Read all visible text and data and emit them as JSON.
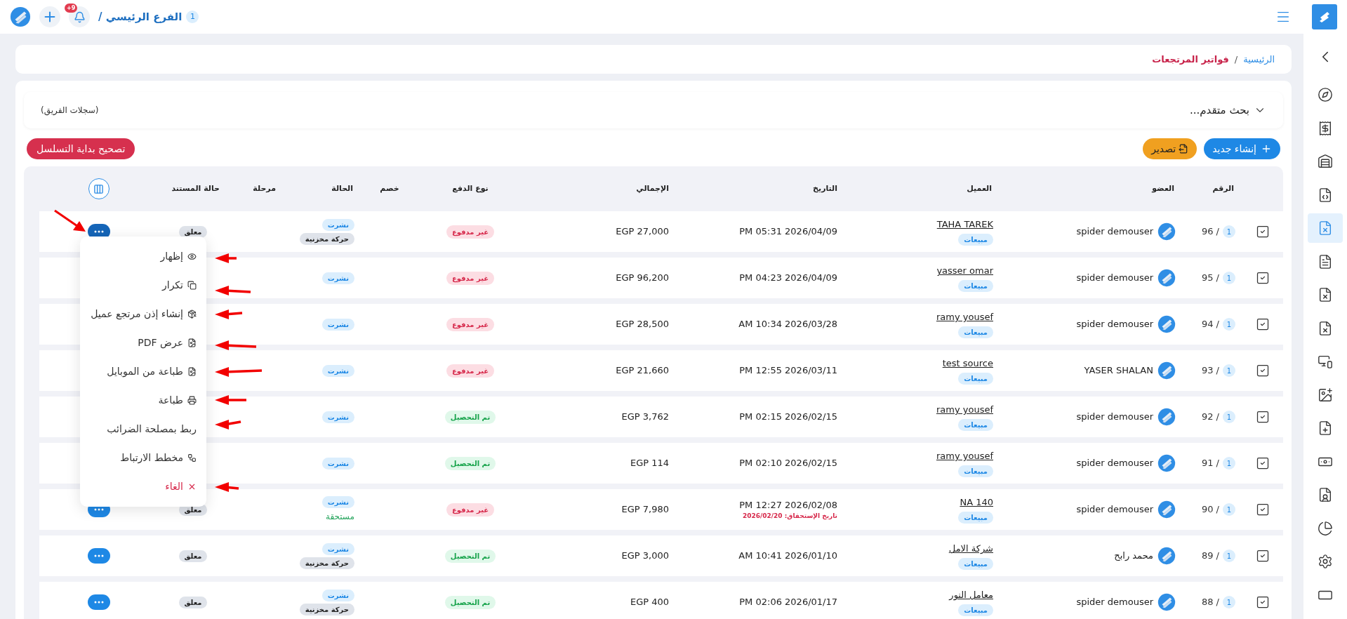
{
  "top_bar": {
    "branch": {
      "badge": "1",
      "name": "الفرع الرئيسي /"
    },
    "notifications": {
      "count": "+9"
    }
  },
  "breadcrumb": {
    "home": "الرئيسية",
    "separator": "/",
    "current": "فواتير المرتجعات"
  },
  "sidebar": {
    "items": [
      {
        "selected": false
      },
      {
        "selected": false
      },
      {
        "selected": false
      },
      {
        "selected": false
      },
      {
        "selected": true
      },
      {
        "selected": false
      },
      {
        "selected": false
      },
      {
        "selected": false
      },
      {
        "selected": false
      },
      {
        "selected": false
      },
      {
        "selected": false
      },
      {
        "selected": false
      },
      {
        "selected": false
      },
      {
        "selected": false
      },
      {
        "selected": false
      },
      {
        "selected": false
      }
    ]
  },
  "search": {
    "label": "بحث متقدم...",
    "expanded": false,
    "scope": "(سجلات الفريق)"
  },
  "actions": {
    "create": "إنشاء جديد",
    "export": "تصدير",
    "fix_sequence": "تصحيح بداية التسلسل"
  },
  "table": {
    "columns": [
      "الرقم",
      "العضو",
      "العميل",
      "التاريخ",
      "الإجمالي",
      "نوع الدفع",
      "خصم",
      "الحالة",
      "مرحلة",
      "حالة المستند"
    ],
    "rows": [
      {
        "checked": true,
        "branch": "1",
        "number": "96 /",
        "member": "spider demouser",
        "client": "TAHA TAREK",
        "client_type": "مبيعات",
        "date": "PM 05:31 2026/04/09",
        "total": "EGP 27,000",
        "payment": {
          "label": "غير مدفوع",
          "kind": "unpaid"
        },
        "status": [
          {
            "kind": "published",
            "label": "نشرت"
          },
          {
            "kind": "stock",
            "label": "حركة مخزنية"
          }
        ],
        "doc_status": "معلق",
        "menu_open": true
      },
      {
        "checked": true,
        "branch": "1",
        "number": "95 /",
        "member": "spider demouser",
        "client": "yasser omar",
        "client_type": "مبيعات",
        "date": "PM 04:23 2026/04/09",
        "total": "EGP 96,200",
        "payment": {
          "label": "غير مدفوع",
          "kind": "unpaid"
        },
        "status": [
          {
            "kind": "published",
            "label": "نشرت"
          }
        ]
      },
      {
        "checked": true,
        "branch": "1",
        "number": "94 /",
        "member": "spider demouser",
        "client": "ramy yousef",
        "client_type": "مبيعات",
        "date": "AM 10:34 2026/03/28",
        "total": "EGP 28,500",
        "payment": {
          "label": "غير مدفوع",
          "kind": "unpaid"
        },
        "status": [
          {
            "kind": "published",
            "label": "نشرت"
          }
        ]
      },
      {
        "checked": true,
        "branch": "1",
        "number": "93 /",
        "member": "YASER SHALAN",
        "client": "test source",
        "client_type": "مبيعات",
        "date": "PM 12:55 2026/03/11",
        "total": "EGP 21,660",
        "payment": {
          "label": "غير مدفوع",
          "kind": "unpaid"
        },
        "status": [
          {
            "kind": "published",
            "label": "نشرت"
          }
        ]
      },
      {
        "checked": true,
        "branch": "1",
        "number": "92 /",
        "member": "spider demouser",
        "client": "ramy yousef",
        "client_type": "مبيعات",
        "date": "PM 02:15 2026/02/15",
        "total": "EGP 3,762",
        "payment": {
          "label": "تم التحصيل",
          "kind": "paid"
        },
        "status": [
          {
            "kind": "published",
            "label": "نشرت"
          }
        ]
      },
      {
        "checked": true,
        "branch": "1",
        "number": "91 /",
        "member": "spider demouser",
        "client": "ramy yousef",
        "client_type": "مبيعات",
        "date": "PM 02:10 2026/02/15",
        "total": "EGP 114",
        "payment": {
          "label": "تم التحصيل",
          "kind": "paid"
        },
        "status": [
          {
            "kind": "published",
            "label": "نشرت"
          }
        ]
      },
      {
        "checked": true,
        "branch": "1",
        "number": "90 /",
        "member": "spider demouser",
        "client": "NA 140",
        "client_type": "مبيعات",
        "date": "PM 12:27 2026/02/08",
        "due": "تاريخ الإستحقاق: 2026/02/20",
        "total": "EGP 7,980",
        "payment": {
          "label": "غير مدفوع",
          "kind": "unpaid"
        },
        "status": [
          {
            "kind": "published",
            "label": "نشرت"
          },
          {
            "kind": "due",
            "label": "مستحقة"
          }
        ],
        "doc_status": "معلق",
        "menu_open": false
      },
      {
        "checked": true,
        "branch": "1",
        "number": "89 /",
        "member": "محمد رابح",
        "client": "شركة الامل",
        "client_type": "مبيعات",
        "date": "AM 10:41 2026/01/10",
        "total": "EGP 3,000",
        "payment": {
          "label": "تم التحصيل",
          "kind": "paid"
        },
        "status": [
          {
            "kind": "published",
            "label": "نشرت"
          },
          {
            "kind": "stock",
            "label": "حركة مخزنية"
          }
        ],
        "doc_status": "معلق",
        "menu_open": false
      },
      {
        "checked": true,
        "branch": "1",
        "number": "88 /",
        "member": "spider demouser",
        "client": "معامل النور",
        "client_type": "مبيعات",
        "date": "PM 02:06 2026/01/17",
        "total": "EGP 400",
        "payment": {
          "label": "تم التحصيل",
          "kind": "paid"
        },
        "status": [
          {
            "kind": "published",
            "label": "نشرت"
          },
          {
            "kind": "stock",
            "label": "حركة مخزنية"
          }
        ],
        "doc_status": "معلق",
        "menu_open": false
      }
    ]
  },
  "row_menu": {
    "items": [
      {
        "label": "إظهار",
        "kind": "normal"
      },
      {
        "label": "تكرار",
        "kind": "normal"
      },
      {
        "label": "إنشاء إذن مرتجع عميل",
        "kind": "normal"
      },
      {
        "label": "عرض PDF",
        "kind": "normal"
      },
      {
        "label": "طباعة من الموبايل",
        "kind": "normal"
      },
      {
        "label": "طباعة",
        "kind": "normal"
      },
      {
        "label": "ربط بمصلحة الضرائب",
        "kind": "normal"
      },
      {
        "label": "مخطط الارتباط",
        "kind": "normal"
      },
      {
        "label": "الغاء",
        "kind": "danger"
      }
    ]
  }
}
